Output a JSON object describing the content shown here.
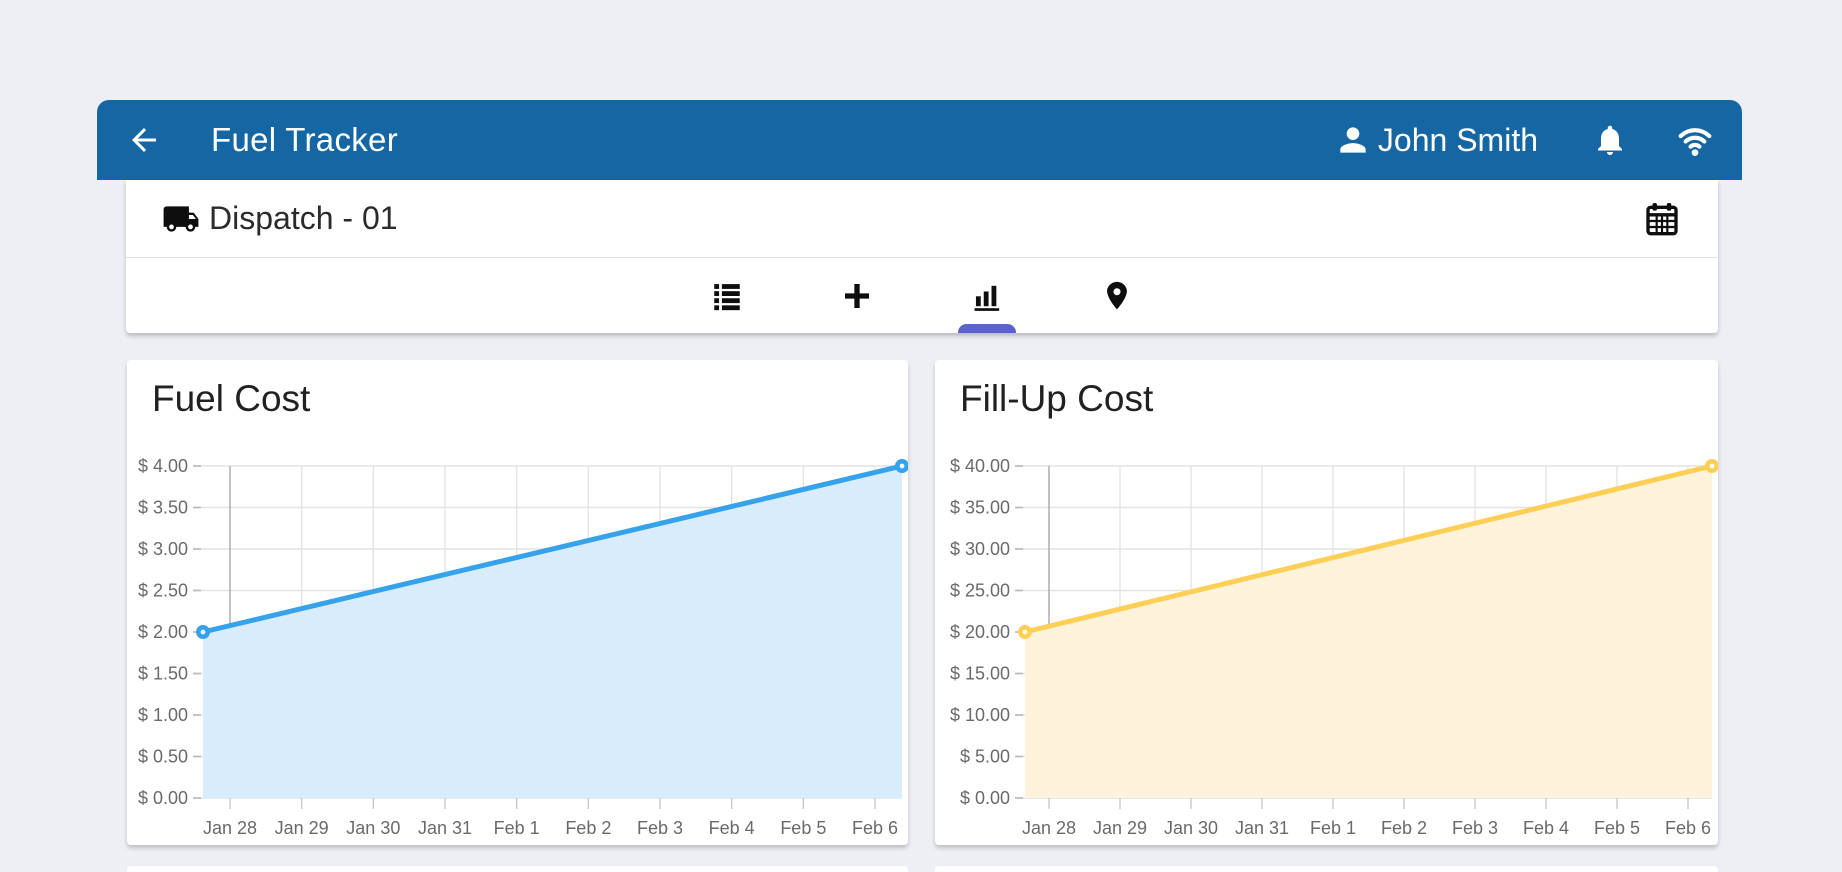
{
  "app_bar": {
    "title": "Fuel Tracker",
    "user_name": "John Smith",
    "color": "#1566a2",
    "icons": [
      "arrow-left-icon",
      "person-icon",
      "bell-icon",
      "wifi-icon"
    ]
  },
  "dispatch_bar": {
    "label": "Dispatch - 01",
    "icons": [
      "truck-icon",
      "calendar-icon"
    ]
  },
  "toolbar": {
    "items": [
      {
        "icon": "list-icon",
        "selected": false
      },
      {
        "icon": "add-icon",
        "selected": false
      },
      {
        "icon": "bar-chart-icon",
        "selected": true
      },
      {
        "icon": "location-pin-icon",
        "selected": false
      }
    ],
    "indicator_color": "#5b63c5"
  },
  "chart_data": [
    {
      "type": "area",
      "title": "Fuel Cost",
      "x_ticks": [
        "Jan 28",
        "Jan 29",
        "Jan 30",
        "Jan 31",
        "Feb 1",
        "Feb 2",
        "Feb 3",
        "Feb 4",
        "Feb 5",
        "Feb 6"
      ],
      "y_ticks": [
        "$ 4.00",
        "$ 3.50",
        "$ 3.00",
        "$ 2.50",
        "$ 2.00",
        "$ 1.50",
        "$ 1.00",
        "$ 0.50",
        "$ 0.00"
      ],
      "ylim": [
        0,
        4
      ],
      "y_step": 0.5,
      "points": [
        {
          "label": "Jan 28",
          "value": 2.0
        },
        {
          "label": "Feb 6",
          "value": 4.0
        }
      ],
      "line_color": "#36a2eb",
      "fill_color": "#d9ecfb",
      "grid": true,
      "legend": "none"
    },
    {
      "type": "area",
      "title": "Fill-Up Cost",
      "x_ticks": [
        "Jan 28",
        "Jan 29",
        "Jan 30",
        "Jan 31",
        "Feb 1",
        "Feb 2",
        "Feb 3",
        "Feb 4",
        "Feb 5",
        "Feb 6"
      ],
      "y_ticks": [
        "$ 40.00",
        "$ 35.00",
        "$ 30.00",
        "$ 25.00",
        "$ 20.00",
        "$ 15.00",
        "$ 10.00",
        "$ 5.00",
        "$ 0.00"
      ],
      "ylim": [
        0,
        40
      ],
      "y_step": 5,
      "points": [
        {
          "label": "Jan 28",
          "value": 20.0
        },
        {
          "label": "Feb 6",
          "value": 40.0
        }
      ],
      "line_color": "#fdcf56",
      "fill_color": "#fcf3da",
      "grid": true,
      "legend": "none"
    }
  ]
}
